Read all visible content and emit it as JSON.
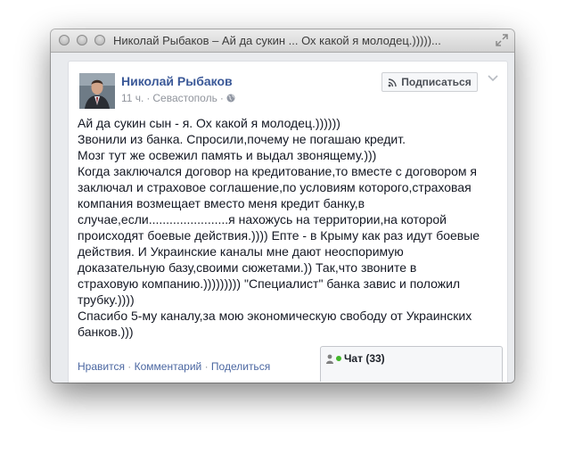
{
  "window": {
    "title": "Николай Рыбаков – Ай да сукин ... Ох какой я молодец.)))))..."
  },
  "post": {
    "author": "Николай Рыбаков",
    "time": "11 ч.",
    "separator": "·",
    "location": "Севастополь",
    "subscribe_label": "Подписаться",
    "lines": [
      "Ай да сукин сын - я. Ох какой я молодец.))))))",
      "Звонили из банка. Спросили,почему не погашаю кредит.",
      "Мозг тут же освежил память и выдал звонящему.)))",
      "Когда заключался договор на кредитование,то вместе с договором я",
      "заключал и страховое соглашение,по условиям которого,страховая",
      "компания возмещает вместо меня кредит банку,в",
      "случае,если.......................я нахожусь на территории,на которой",
      "происходят боевые действия.)))) Епте - в Крыму как раз идут боевые",
      "действия. И Украинские каналы мне дают неоспоримую",
      "доказательную базу,своими сюжетами.)) Так,что звоните в",
      "страховую компанию.))))))))) \"Специалист\" банка завис и положил",
      "трубку.))))",
      "Спасибо 5-му каналу,за мою экономическую свободу от Украинских",
      "банков.)))"
    ],
    "actions": {
      "like": "Нравится",
      "comment": "Комментарий",
      "share": "Поделиться",
      "separator": "·"
    }
  },
  "chat": {
    "label": "Чат (33)"
  },
  "icons": [
    "close-icon",
    "minimize-icon",
    "zoom-icon",
    "fullscreen-icon",
    "globe-icon",
    "rss-icon",
    "chevron-down-icon",
    "person-icon",
    "online-dot-icon"
  ],
  "colors": {
    "link": "#3b5998",
    "online": "#42b72a"
  }
}
